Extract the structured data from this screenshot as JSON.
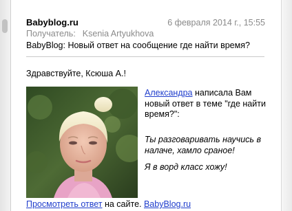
{
  "email": {
    "sender": "Babyblog.ru",
    "date": "6 февраля 2014 г., 15:55",
    "recipient_label": "Получатель:",
    "recipient_name": "Ksenia Artyukhova",
    "subject": "BabyBlog: Новый ответ на сообщение где найти время?"
  },
  "body": {
    "greeting": "Здравствуйте, Ксюша А.!",
    "author_link": "Александра",
    "notice_text": " написала Вам новый ответ в теме \"где найти время?\":",
    "quote_1": "Ты разговаривать научись в налаче, хамло сраное!",
    "quote_2": "Я в ворд класс хожу!",
    "view_link": "Просмотреть ответ",
    "footer_mid": " на сайте. ",
    "site_link": "BabyBlog.ru"
  },
  "colors": {
    "link": "#1f3dcc",
    "meta_text": "#8a8a8a"
  }
}
